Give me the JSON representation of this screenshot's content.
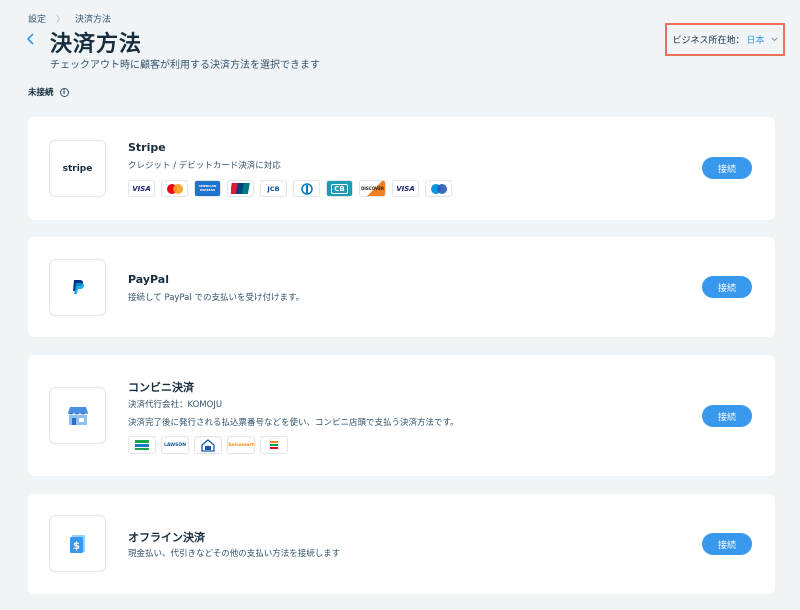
{
  "breadcrumb": {
    "parent": "設定",
    "separator": "〉",
    "current": "決済方法"
  },
  "page": {
    "title": "決済方法",
    "subtitle": "チェックアウト時に顧客が利用する決済方法を選択できます",
    "section_label": "未接続"
  },
  "location": {
    "label": "ビジネス所在地：",
    "value": "日本"
  },
  "providers": [
    {
      "name": "Stripe",
      "description": "クレジット / デビットカード決済に対応",
      "logo_text": "stripe",
      "button": "接続"
    },
    {
      "name": "PayPal",
      "description": "接続して PayPal での支払いを受け付けます。",
      "button": "接続"
    },
    {
      "name": "コンビニ決済",
      "description": "決済代行会社：KOMOJU",
      "description2": "決済完了後に発行される払込票番号などを使い、コンビニ店頭で支払う決済方法です。",
      "button": "接続"
    },
    {
      "name": "オフライン決済",
      "description": "現金払い、代引きなどその他の支払い方法を接続します",
      "button": "接続"
    }
  ],
  "card_brands": {
    "visa": "VISA",
    "amex": "AMERICAN EXPRESS",
    "jcb": "JCB",
    "cb": "CB",
    "discover": "DISCOVER",
    "visa2": "VISA"
  },
  "konbini_brands": {
    "lawson": "LAWSON",
    "daily": "DAILY",
    "seicomart": "Seicomart"
  },
  "colors": {
    "accent": "#3899ec",
    "highlight": "#f0715b",
    "background": "#f0f4f7",
    "text": "#162d3d"
  }
}
